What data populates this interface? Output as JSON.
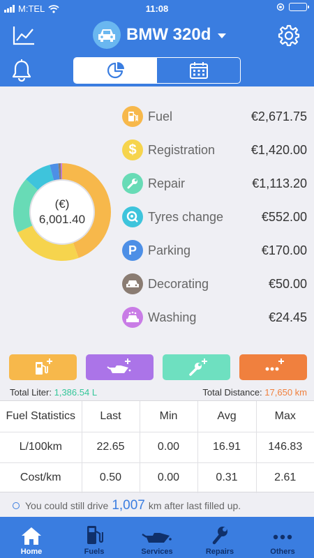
{
  "status_bar": {
    "carrier": "M:TEL",
    "time": "11:08"
  },
  "header": {
    "car_name": "BMW 320d",
    "segments": [
      {
        "icon": "pie-chart-icon",
        "active": true
      },
      {
        "icon": "calendar-icon",
        "active": false
      }
    ]
  },
  "summary": {
    "currency_label": "(€)",
    "total": "6,001.40",
    "expenses": [
      {
        "name": "Fuel",
        "value": "€2,671.75",
        "amount": 2671.75,
        "color": "#f7b84b",
        "icon": "fuel-pump-icon"
      },
      {
        "name": "Registration",
        "value": "€1,420.00",
        "amount": 1420.0,
        "color": "#f6d44d",
        "icon": "dollar-icon"
      },
      {
        "name": "Repair",
        "value": "€1,113.20",
        "amount": 1113.2,
        "color": "#68dbb6",
        "icon": "wrench-icon"
      },
      {
        "name": "Tyres change",
        "value": "€552.00",
        "amount": 552.0,
        "color": "#3ec4dc",
        "icon": "tyre-icon"
      },
      {
        "name": "Parking",
        "value": "€170.00",
        "amount": 170.0,
        "color": "#4d8fe6",
        "icon": "parking-icon"
      },
      {
        "name": "Decorating",
        "value": "€50.00",
        "amount": 50.0,
        "color": "#8a7c72",
        "icon": "car-decorating-icon"
      },
      {
        "name": "Washing",
        "value": "€24.45",
        "amount": 24.45,
        "color": "#c97ce6",
        "icon": "car-wash-icon"
      }
    ]
  },
  "quick_add": [
    {
      "name": "add-fuel",
      "color": "#f7b84b"
    },
    {
      "name": "add-service",
      "color": "#ab74e8"
    },
    {
      "name": "add-repair",
      "color": "#6ee0c0"
    },
    {
      "name": "add-other",
      "color": "#f0803e"
    }
  ],
  "totals": {
    "liter_label": "Total Liter:",
    "liter_value": "1,386.54 L",
    "distance_label": "Total Distance:",
    "distance_value": "17,650 km"
  },
  "fuel_stats": {
    "headers": [
      "Fuel Statistics",
      "Last",
      "Min",
      "Avg",
      "Max"
    ],
    "rows": [
      [
        "L/100km",
        "22.65",
        "0.00",
        "16.91",
        "146.83"
      ],
      [
        "Cost/km",
        "0.50",
        "0.00",
        "0.31",
        "2.61"
      ]
    ]
  },
  "note": {
    "prefix": "You could still drive",
    "value": "1,007",
    "suffix": "km after last filled up."
  },
  "tabs": [
    {
      "label": "Home",
      "icon": "home-icon",
      "active": true
    },
    {
      "label": "Fuels",
      "icon": "fuel-pump-icon",
      "active": false
    },
    {
      "label": "Services",
      "icon": "oil-can-icon",
      "active": false
    },
    {
      "label": "Repairs",
      "icon": "wrench-icon",
      "active": false
    },
    {
      "label": "Others",
      "icon": "more-icon",
      "active": false
    }
  ]
}
